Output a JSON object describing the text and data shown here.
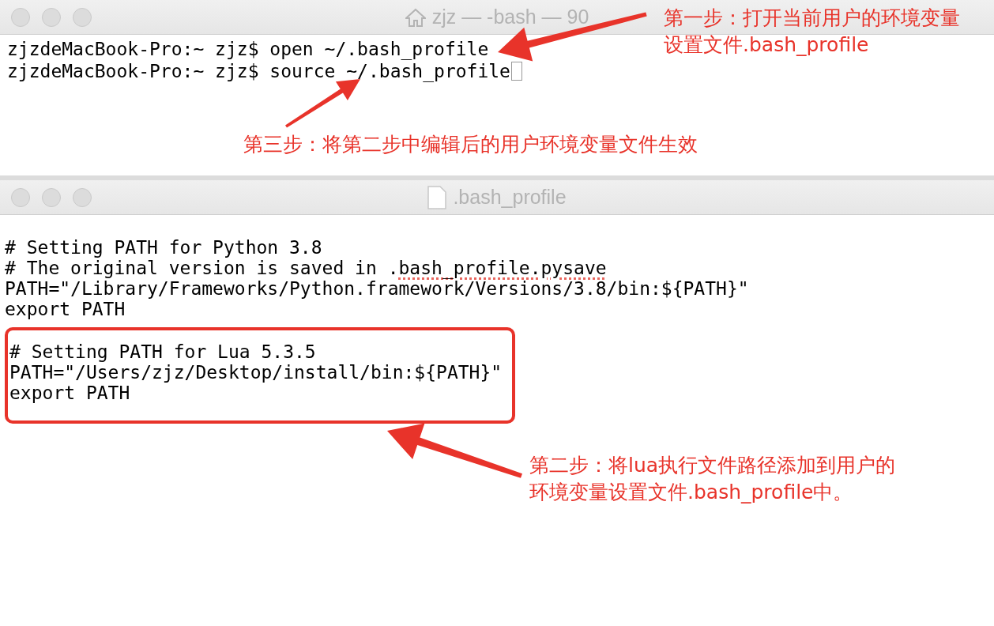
{
  "terminal": {
    "title": "zjz — -bash — 90",
    "lines": [
      {
        "text": "zjzdeMacBook-Pro:~ zjz$ open ~/.bash_profile",
        "cursor": false
      },
      {
        "text": "zjzdeMacBook-Pro:~ zjz$ source ~/.bash_profile",
        "cursor": true
      }
    ]
  },
  "editor": {
    "title": ".bash_profile",
    "blocks": [
      {
        "highlighted": false,
        "lines": [
          [
            {
              "text": "# Setting PATH for Python 3.8",
              "misspelled": false
            }
          ],
          [
            {
              "text": "# The original version is saved in .",
              "misspelled": false
            },
            {
              "text": "bash_profile.pysave",
              "misspelled": true
            }
          ],
          [
            {
              "text": "PATH=\"/Library/Frameworks/Python.framework/Versions/3.8/bin:${PATH}\"",
              "misspelled": false
            }
          ],
          [
            {
              "text": "export PATH",
              "misspelled": false
            }
          ]
        ]
      },
      {
        "highlighted": true,
        "lines": [
          [
            {
              "text": "# Setting PATH for Lua 5.3.5",
              "misspelled": false
            }
          ],
          [
            {
              "text": "PATH=\"/Users/zjz/Desktop/install/bin:${PATH}\"",
              "misspelled": false
            }
          ],
          [
            {
              "text": "export PATH",
              "misspelled": false
            }
          ]
        ]
      }
    ]
  },
  "annotations": [
    {
      "lines": [
        "第一步：打开当前用户的环境变量",
        "设置文件.bash_profile"
      ]
    },
    {
      "lines": [
        "第三步：将第二步中编辑后的用户环境变量文件生效"
      ]
    },
    {
      "lines": [
        "第二步：将lua执行文件路径添加到用户的",
        "环境变量设置文件.bash_profile中。"
      ]
    }
  ]
}
